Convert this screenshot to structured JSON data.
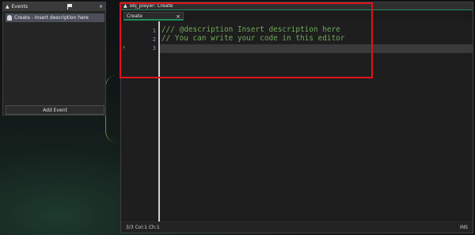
{
  "events_panel": {
    "title": "Events",
    "pin_icon": "triangle-pin-icon",
    "flag_icon": "flag-icon",
    "close_icon": "close-icon",
    "items": [
      {
        "label": "Create - Insert description here",
        "icon": "lightbulb-icon"
      }
    ],
    "add_event_label": "Add Event"
  },
  "editor": {
    "title": "obj_player: Create",
    "tabs": [
      {
        "label": "Create",
        "close": "×"
      }
    ],
    "lines": [
      {
        "number": "1",
        "text": "/// @description Insert description here"
      },
      {
        "number": "2",
        "text": "// You can write your code in this editor"
      },
      {
        "number": "3",
        "text": ""
      }
    ],
    "status": {
      "position": "3/3 Col:1 Ch:1",
      "mode": "INS"
    }
  },
  "glyphs": {
    "pin": "▲",
    "close": "×",
    "fold": "›"
  },
  "colors": {
    "comment": "#6fa85a",
    "line_number": "#7a96c8",
    "accent_green": "#1f8c5c",
    "highlight_red": "#e0131b"
  }
}
